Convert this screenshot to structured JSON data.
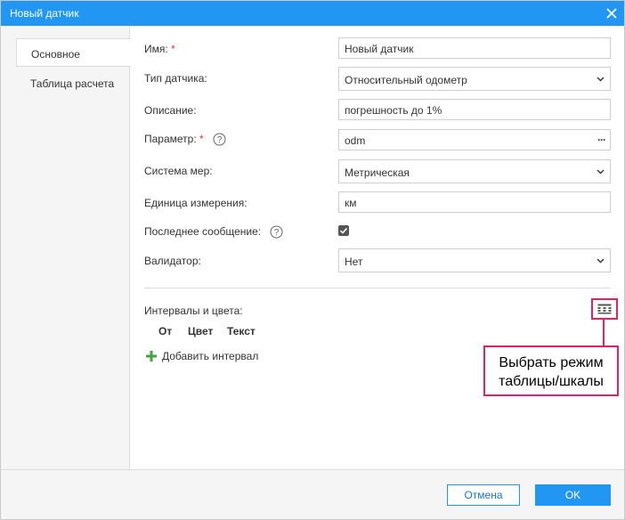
{
  "dialog": {
    "title": "Новый датчик"
  },
  "tabs": [
    {
      "label": "Основное",
      "active": true
    },
    {
      "label": "Таблица расчета",
      "active": false
    }
  ],
  "form": {
    "name": {
      "label": "Имя:",
      "required_mark": "*",
      "value": "Новый датчик"
    },
    "sensor_type": {
      "label": "Тип датчика:",
      "value": "Относительный одометр"
    },
    "description": {
      "label": "Описание:",
      "value": "погрешность до 1%"
    },
    "parameter": {
      "label": "Параметр:",
      "required_mark": "*",
      "value": "odm",
      "more": "···"
    },
    "measure_system": {
      "label": "Система мер:",
      "value": "Метрическая"
    },
    "unit": {
      "label": "Единица измерения:",
      "value": "км"
    },
    "last_message": {
      "label": "Последнее сообщение:",
      "checked": true
    },
    "validator": {
      "label": "Валидатор:",
      "value": "Нет"
    }
  },
  "intervals": {
    "label": "Интервалы и цвета:",
    "columns": [
      "От",
      "Цвет",
      "Текст"
    ],
    "add_label": "Добавить интервал"
  },
  "callout": {
    "line1": "Выбрать режим",
    "line2": "таблицы/шкалы"
  },
  "footer": {
    "cancel_label": "Отмена",
    "ok_label": "OK"
  },
  "colors": {
    "accent": "#2196f3",
    "highlight": "#e0245e",
    "add_icon": "#43a047"
  }
}
